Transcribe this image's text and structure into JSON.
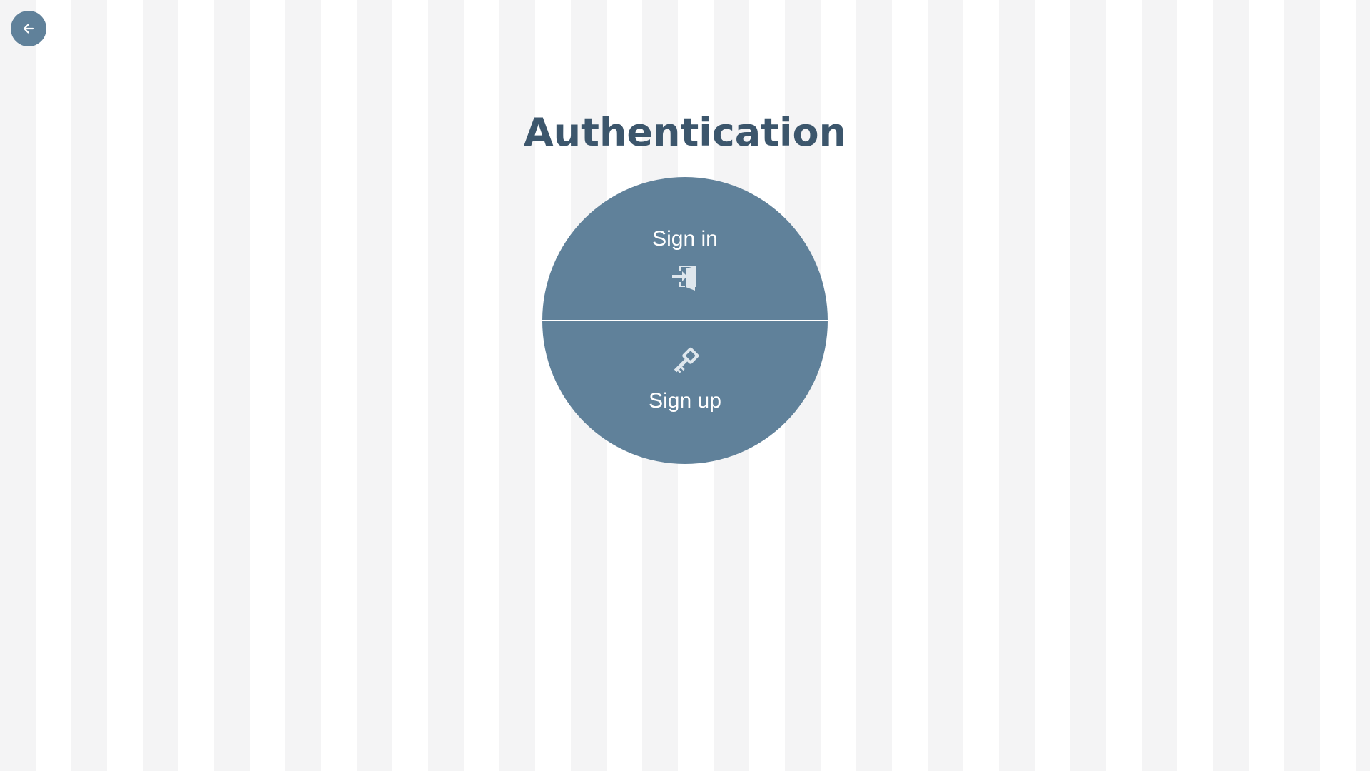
{
  "back": {
    "icon": "arrow-left-icon"
  },
  "title": "Authentication",
  "auth": {
    "sign_in": {
      "label": "Sign in",
      "icon": "sign-in-door-icon"
    },
    "sign_up": {
      "label": "Sign up",
      "icon": "key-icon"
    }
  },
  "colors": {
    "accent": "#60819a",
    "title": "#3c566c",
    "stripe_light": "#f4f4f5",
    "stripe_white": "#ffffff"
  }
}
